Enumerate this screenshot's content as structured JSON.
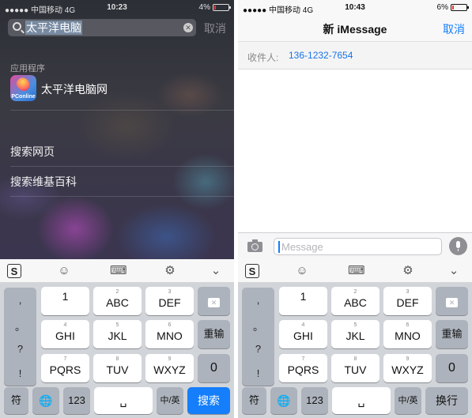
{
  "left": {
    "status": {
      "carrier": "●●●●● 中国移动  4G",
      "time": "10:23",
      "battery": "4%",
      "battery_level": 0.04
    },
    "search": {
      "query": "太平洋电脑",
      "cancel": "取消"
    },
    "section_label": "应用程序",
    "app": {
      "name": "太平洋电脑网",
      "icon_text": "PConline"
    },
    "results": [
      "搜索网页",
      "搜索维基百科"
    ],
    "keyboard": {
      "punct": [
        ",",
        "。",
        "?",
        "!"
      ],
      "rows": [
        [
          {
            "sub": "",
            "main": "1"
          },
          {
            "sub": "2",
            "main": "ABC"
          },
          {
            "sub": "3",
            "main": "DEF"
          }
        ],
        [
          {
            "sub": "4",
            "main": "GHI"
          },
          {
            "sub": "5",
            "main": "JKL"
          },
          {
            "sub": "6",
            "main": "MNO"
          }
        ],
        [
          {
            "sub": "7",
            "main": "PQRS"
          },
          {
            "sub": "8",
            "main": "TUV"
          },
          {
            "sub": "9",
            "main": "WXYZ"
          }
        ]
      ],
      "reenter": "重输",
      "zero": "0",
      "fu": "符",
      "num": "123",
      "lang": "中/英",
      "action": "搜索"
    }
  },
  "right": {
    "status": {
      "carrier": "●●●●● 中国移动  4G",
      "time": "10:43",
      "battery": "6%",
      "battery_level": 0.06
    },
    "header": {
      "title": "新 iMessage",
      "cancel": "取消"
    },
    "to": {
      "label": "收件人:",
      "number": "136-1232-7654"
    },
    "compose": {
      "placeholder": "Message"
    },
    "keyboard": {
      "punct": [
        ",",
        "。",
        "?",
        "!"
      ],
      "rows": [
        [
          {
            "sub": "",
            "main": "1"
          },
          {
            "sub": "2",
            "main": "ABC"
          },
          {
            "sub": "3",
            "main": "DEF"
          }
        ],
        [
          {
            "sub": "4",
            "main": "GHI"
          },
          {
            "sub": "5",
            "main": "JKL"
          },
          {
            "sub": "6",
            "main": "MNO"
          }
        ],
        [
          {
            "sub": "7",
            "main": "PQRS"
          },
          {
            "sub": "8",
            "main": "TUV"
          },
          {
            "sub": "9",
            "main": "WXYZ"
          }
        ]
      ],
      "reenter": "重输",
      "zero": "0",
      "fu": "符",
      "num": "123",
      "lang": "中/英",
      "action": "换行"
    }
  },
  "colors": {
    "accent": "#157efb",
    "keyboard_bg": "#d1d4d9",
    "battery_low": "#e53935"
  }
}
